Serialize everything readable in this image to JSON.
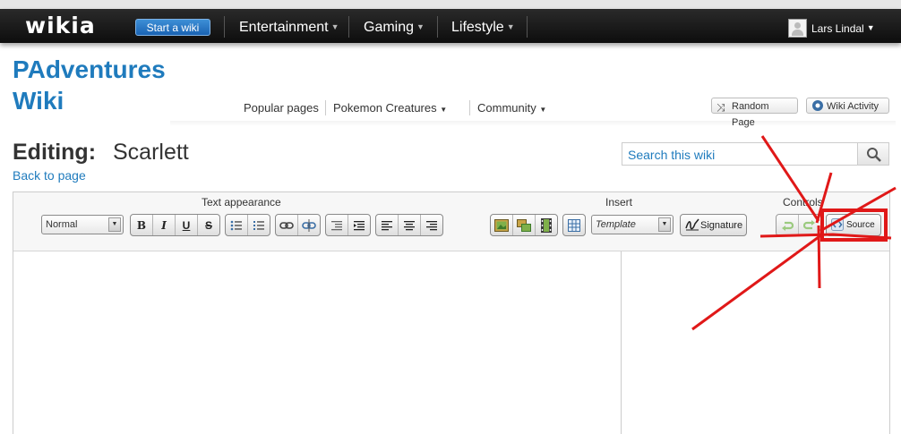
{
  "global_nav": {
    "logo": "wikia",
    "start_wiki": "Start a wiki",
    "items": [
      {
        "label": "Entertainment"
      },
      {
        "label": "Gaming"
      },
      {
        "label": "Lifestyle"
      }
    ],
    "user_name": "Lars Lindal"
  },
  "wiki_header": {
    "title_line1": "PAdventures",
    "title_line2": "Wiki",
    "nav": [
      {
        "label": "Popular pages"
      },
      {
        "label": "Pokemon Creatures"
      },
      {
        "label": "Community"
      }
    ],
    "random_page": "Random Page",
    "wiki_activity": "Wiki Activity"
  },
  "page": {
    "editing_label": "Editing:",
    "title": "Scarlett",
    "back_link": "Back to page",
    "search_placeholder": "Search this wiki"
  },
  "editor": {
    "group_text_appearance": "Text appearance",
    "group_insert": "Insert",
    "group_controls": "Controls",
    "format_select": "Normal",
    "bold": "B",
    "italic": "I",
    "underline": "U",
    "strike": "S",
    "template_select": "Template",
    "signature": "Signature",
    "source": "Source"
  },
  "colors": {
    "wiki_blue": "#1f7bbd",
    "nav_bg": "#111111",
    "annotation_red": "#e01818"
  }
}
